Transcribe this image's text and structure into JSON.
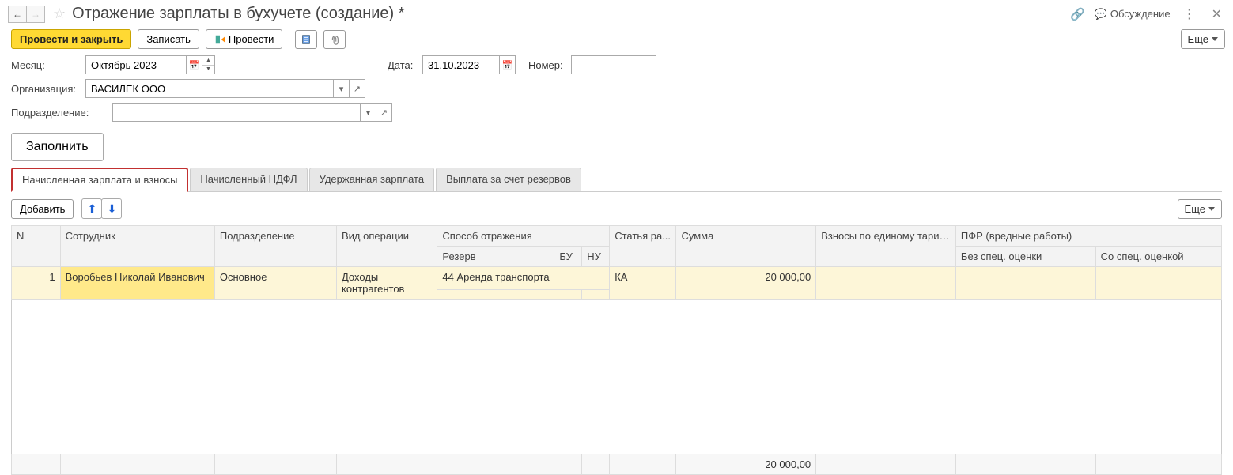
{
  "header": {
    "title": "Отражение зарплаты в бухучете (создание) *",
    "discuss": "Обсуждение"
  },
  "toolbar": {
    "post_close": "Провести и закрыть",
    "write": "Записать",
    "post": "Провести",
    "more": "Еще"
  },
  "form": {
    "month_label": "Месяц:",
    "month_value": "Октябрь 2023",
    "date_label": "Дата:",
    "date_value": "31.10.2023",
    "number_label": "Номер:",
    "number_value": "",
    "org_label": "Организация:",
    "org_value": "ВАСИЛЕК ООО",
    "dept_label": "Подразделение:",
    "dept_value": "",
    "fill": "Заполнить"
  },
  "tabs": [
    "Начисленная зарплата и взносы",
    "Начисленный НДФЛ",
    "Удержанная зарплата",
    "Выплата за счет резервов"
  ],
  "tab_toolbar": {
    "add": "Добавить",
    "more": "Еще"
  },
  "columns": {
    "n": "N",
    "employee": "Сотрудник",
    "department": "Подразделение",
    "op_type": "Вид операции",
    "reflection": "Способ отражения",
    "reserve": "Резерв",
    "bu": "БУ",
    "nu": "НУ",
    "article": "Статья ра...",
    "sum": "Сумма",
    "fee": "Взносы по единому тарифу",
    "pfr": "ПФР (вредные работы)",
    "pfr_no": "Без спец. оценки",
    "pfr_yes": "Со спец. оценкой"
  },
  "rows": [
    {
      "n": "1",
      "employee": "Воробьев Николай Иванович",
      "department": "Основное",
      "op_type": "Доходы контрагентов",
      "reflection": "44 Аренда транспорта",
      "reserve": "",
      "bu": "",
      "nu": "",
      "article": "КА",
      "sum": "20 000,00",
      "fee": "",
      "pfr_no": "",
      "pfr_yes": ""
    }
  ],
  "footer": {
    "sum_total": "20 000,00"
  }
}
